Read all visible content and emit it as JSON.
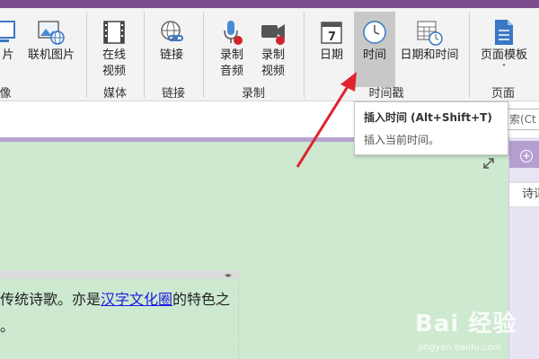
{
  "ribbon": {
    "buttons": [
      {
        "label1": "片",
        "label2": ""
      },
      {
        "label1": "联机图片",
        "label2": ""
      },
      {
        "label1": "在线",
        "label2": "视频"
      },
      {
        "label1": "链接",
        "label2": ""
      },
      {
        "label1": "录制",
        "label2": "音频"
      },
      {
        "label1": "录制",
        "label2": "视频"
      },
      {
        "label1": "日期",
        "label2": ""
      },
      {
        "label1": "时间",
        "label2": ""
      },
      {
        "label1": "日期和时间",
        "label2": ""
      },
      {
        "label1": "页面模板",
        "label2": "˅"
      }
    ],
    "groups": [
      "像",
      "媒体",
      "链接",
      "录制",
      "时间戳",
      "页面"
    ]
  },
  "search": {
    "placeholder": "索(Ct"
  },
  "tooltip": {
    "title": "插入时间 (Alt+Shift+T)",
    "desc": "插入当前时间。"
  },
  "right_pane": {
    "add": "+",
    "item": "诗词"
  },
  "content": {
    "line1_before": "传统诗歌。亦是",
    "line1_link": "汉字文化圈",
    "line1_after": "的特色之",
    "line2": "。",
    "container_handle": "◂▸"
  },
  "watermark": {
    "text": "Bai 经验",
    "url": "jingyan.baidu.com"
  },
  "colors": {
    "accent": "#7b4e8d",
    "page_bg": "#cde9d0",
    "arrow": "#e0232e",
    "link": "#1a1ae0"
  }
}
